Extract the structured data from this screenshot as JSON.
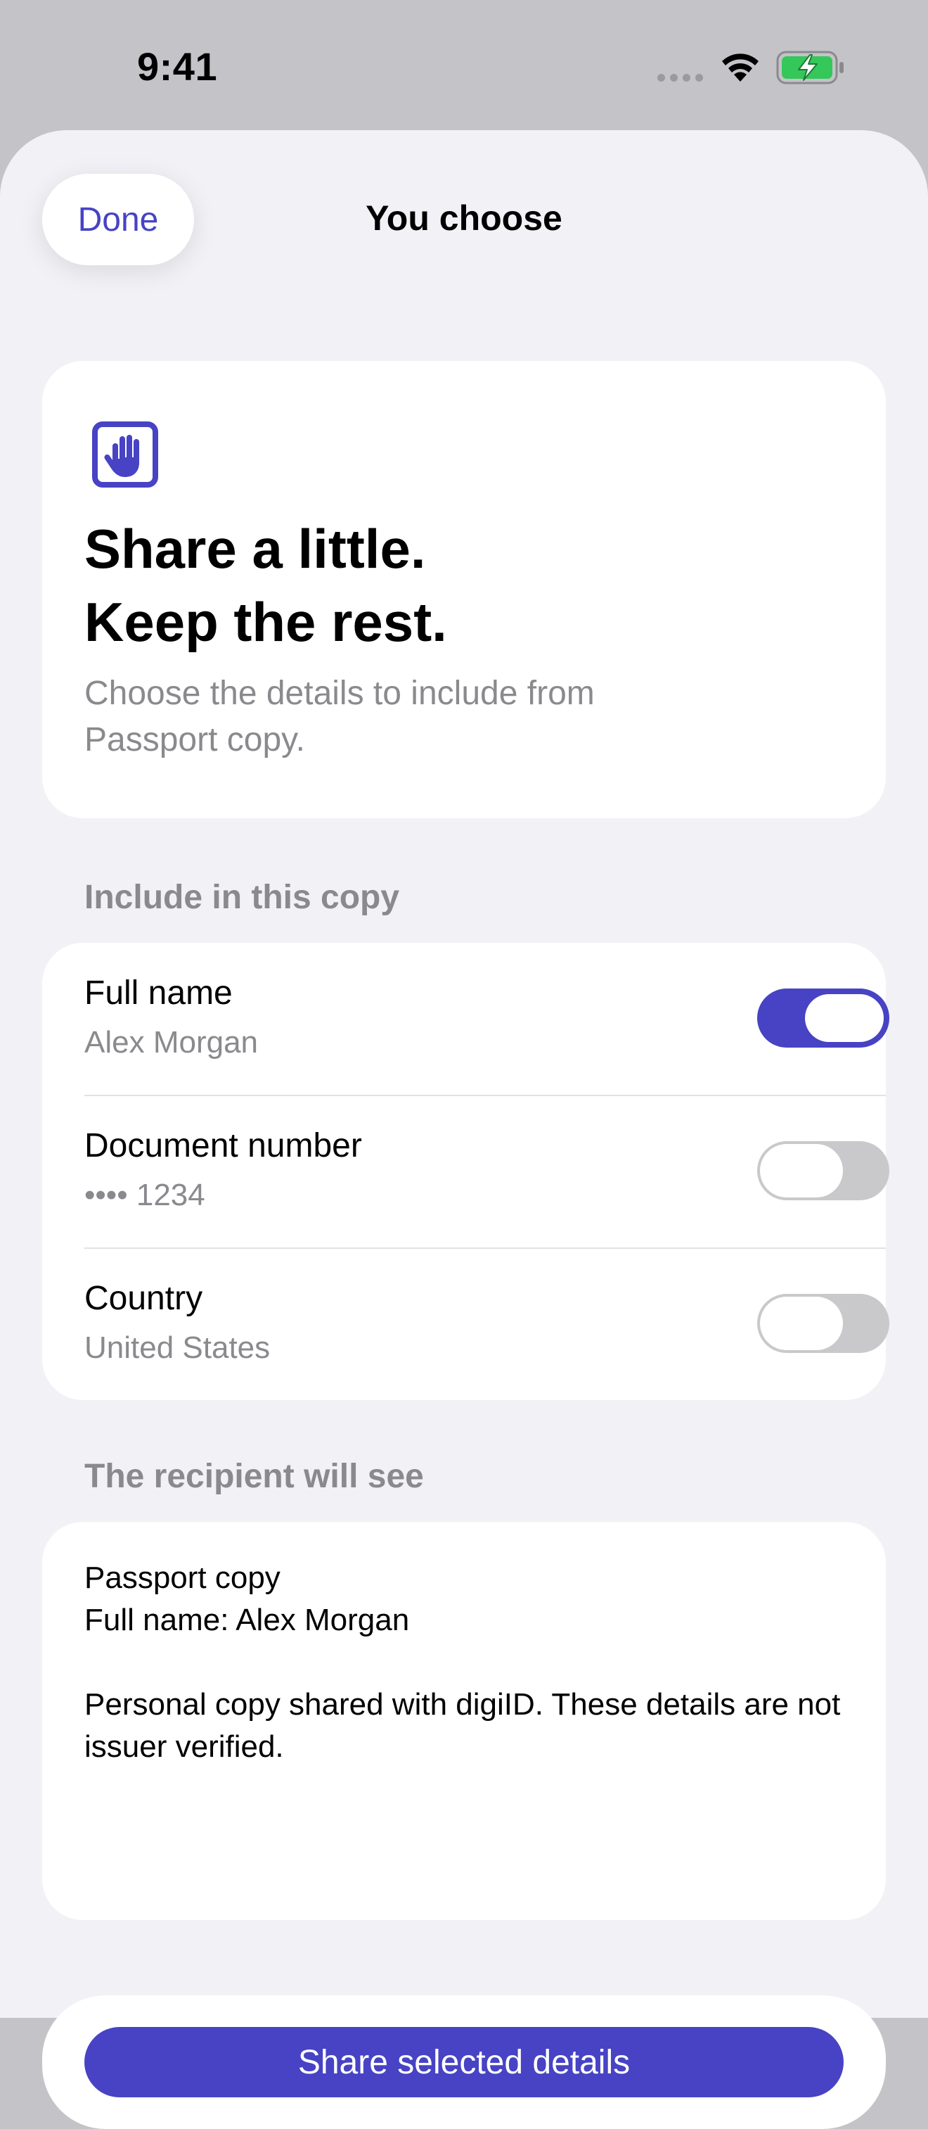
{
  "status_bar": {
    "time": "9:41"
  },
  "sheet": {
    "done_label": "Done",
    "title": "You choose"
  },
  "hero": {
    "icon": "raised-hand-icon",
    "title_line1": "Share a little.",
    "title_line2": "Keep the rest.",
    "subtitle": "Choose the details to include from Passport copy."
  },
  "include_section": {
    "label": "Include in this copy",
    "rows": [
      {
        "title": "Full name",
        "value": "Alex Morgan",
        "enabled": true
      },
      {
        "title": "Document number",
        "value": "•••• 1234",
        "enabled": false
      },
      {
        "title": "Country",
        "value": "United States",
        "enabled": false
      }
    ]
  },
  "recipient_section": {
    "label": "The recipient will see",
    "document": "Passport copy",
    "name_line": "Full name: Alex Morgan",
    "note": "Personal copy shared with digiID. These details are not issuer verified."
  },
  "action": {
    "share_label": "Share selected details"
  },
  "colors": {
    "accent": "#4743c4",
    "battery": "#34c759",
    "background": "#f2f1f6",
    "secondary_text": "#8a8a8e"
  }
}
